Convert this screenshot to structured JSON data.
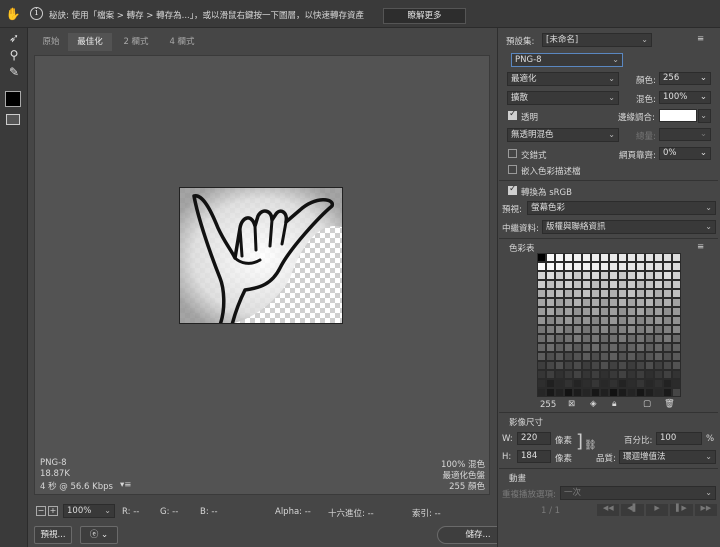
{
  "tip": {
    "icon": "info-icon",
    "text": "秘訣: 使用「檔案 > 轉存 > 轉存為...」，或以滑鼠右鍵按一下圖層，以快速轉存資產",
    "learn_more": "瞭解更多"
  },
  "tools": [
    "hand-icon",
    "slice-select-icon",
    "zoom-icon",
    "eyedropper-icon",
    "foreground-color-swatch",
    "toggle-slices-icon"
  ],
  "tabs": [
    "原始",
    "最佳化",
    "2 欄式",
    "4 欄式"
  ],
  "info_left": {
    "format": "PNG-8",
    "size": "18.87K",
    "time": "4 秒 @ 56.6 Kbps",
    "menu": "▾≡"
  },
  "info_right": {
    "dither": "100% 混色",
    "algo": "最適化色盤",
    "colors": "255 顏色"
  },
  "status": {
    "zoom": "100%",
    "r": "R: --",
    "g": "G: --",
    "b": "B: --",
    "alpha": "Alpha: --",
    "hex": "十六進位: --",
    "index": "索引: --"
  },
  "buttons": {
    "preview": "預視...",
    "save": "儲存...",
    "cancel": "取消",
    "done": "完成"
  },
  "panel": {
    "preset_label": "預設集:",
    "preset_value": "[未命名]",
    "format": "PNG-8",
    "reduction": "最適化",
    "colors_label": "顏色:",
    "colors_value": "256",
    "dither_algo": "擴散",
    "dither_label": "混色:",
    "dither_value": "100%",
    "transparency": "透明",
    "matte_label": "邊緣調合:",
    "trans_dither": "無透明混色",
    "amount_label": "總量:",
    "interlaced": "交錯式",
    "web_snap_label": "網頁靠齊:",
    "web_snap_value": "0%",
    "embed_profile": "嵌入色彩描述檔",
    "convert_srgb": "轉換為 sRGB",
    "preview_label": "預視:",
    "preview_value": "螢幕色彩",
    "metadata_label": "中繼資料:",
    "metadata_value": "版權與聯絡資訊",
    "color_table_title": "色彩表",
    "color_count": "255",
    "image_size_title": "影像尺寸",
    "w_label": "W:",
    "w_value": "220",
    "px1": "像素",
    "h_label": "H:",
    "h_value": "184",
    "px2": "像素",
    "percent_label": "百分比:",
    "percent_value": "100",
    "percent_unit": "%",
    "quality_label": "品質:",
    "quality_value": "環迴增值法",
    "anim_title": "動畫",
    "loop_label": "重複播放選項:",
    "loop_value": "一次",
    "frame_counter": "1 / 1"
  }
}
